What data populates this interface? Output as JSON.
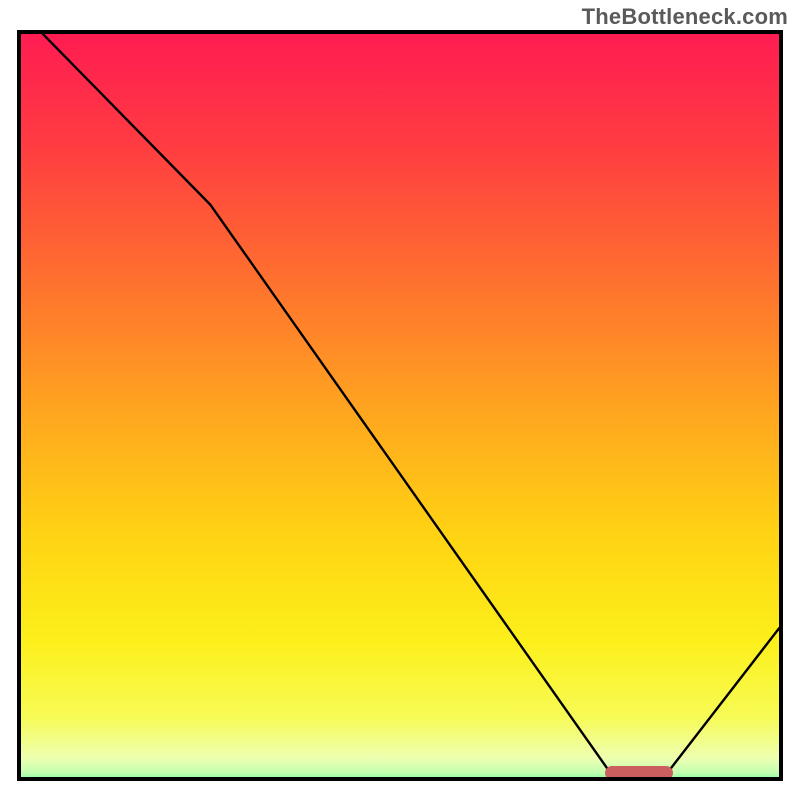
{
  "watermark": "TheBottleneck.com",
  "chart_data": {
    "type": "line",
    "title": "",
    "xlabel": "",
    "ylabel": "",
    "xlim": [
      0,
      100
    ],
    "ylim": [
      0,
      100
    ],
    "series": [
      {
        "name": "curve",
        "x": [
          0,
          25,
          78,
          85,
          100
        ],
        "y": [
          103,
          77,
          0.2,
          0.2,
          20
        ]
      }
    ],
    "gradient_stops": [
      {
        "pos": 0.0,
        "color": "#ff1c52"
      },
      {
        "pos": 0.14,
        "color": "#ff3a42"
      },
      {
        "pos": 0.32,
        "color": "#ff6f2f"
      },
      {
        "pos": 0.5,
        "color": "#ffa61f"
      },
      {
        "pos": 0.66,
        "color": "#ffd313"
      },
      {
        "pos": 0.8,
        "color": "#fcef1a"
      },
      {
        "pos": 0.9,
        "color": "#f7fb55"
      },
      {
        "pos": 0.955,
        "color": "#eeffb0"
      },
      {
        "pos": 0.975,
        "color": "#c2ffb0"
      },
      {
        "pos": 0.99,
        "color": "#4dff91"
      },
      {
        "pos": 1.0,
        "color": "#0dd97a"
      }
    ],
    "marker": {
      "x_start": 77,
      "x_end": 86,
      "y": 0.6,
      "color": "#cb5f60"
    }
  }
}
